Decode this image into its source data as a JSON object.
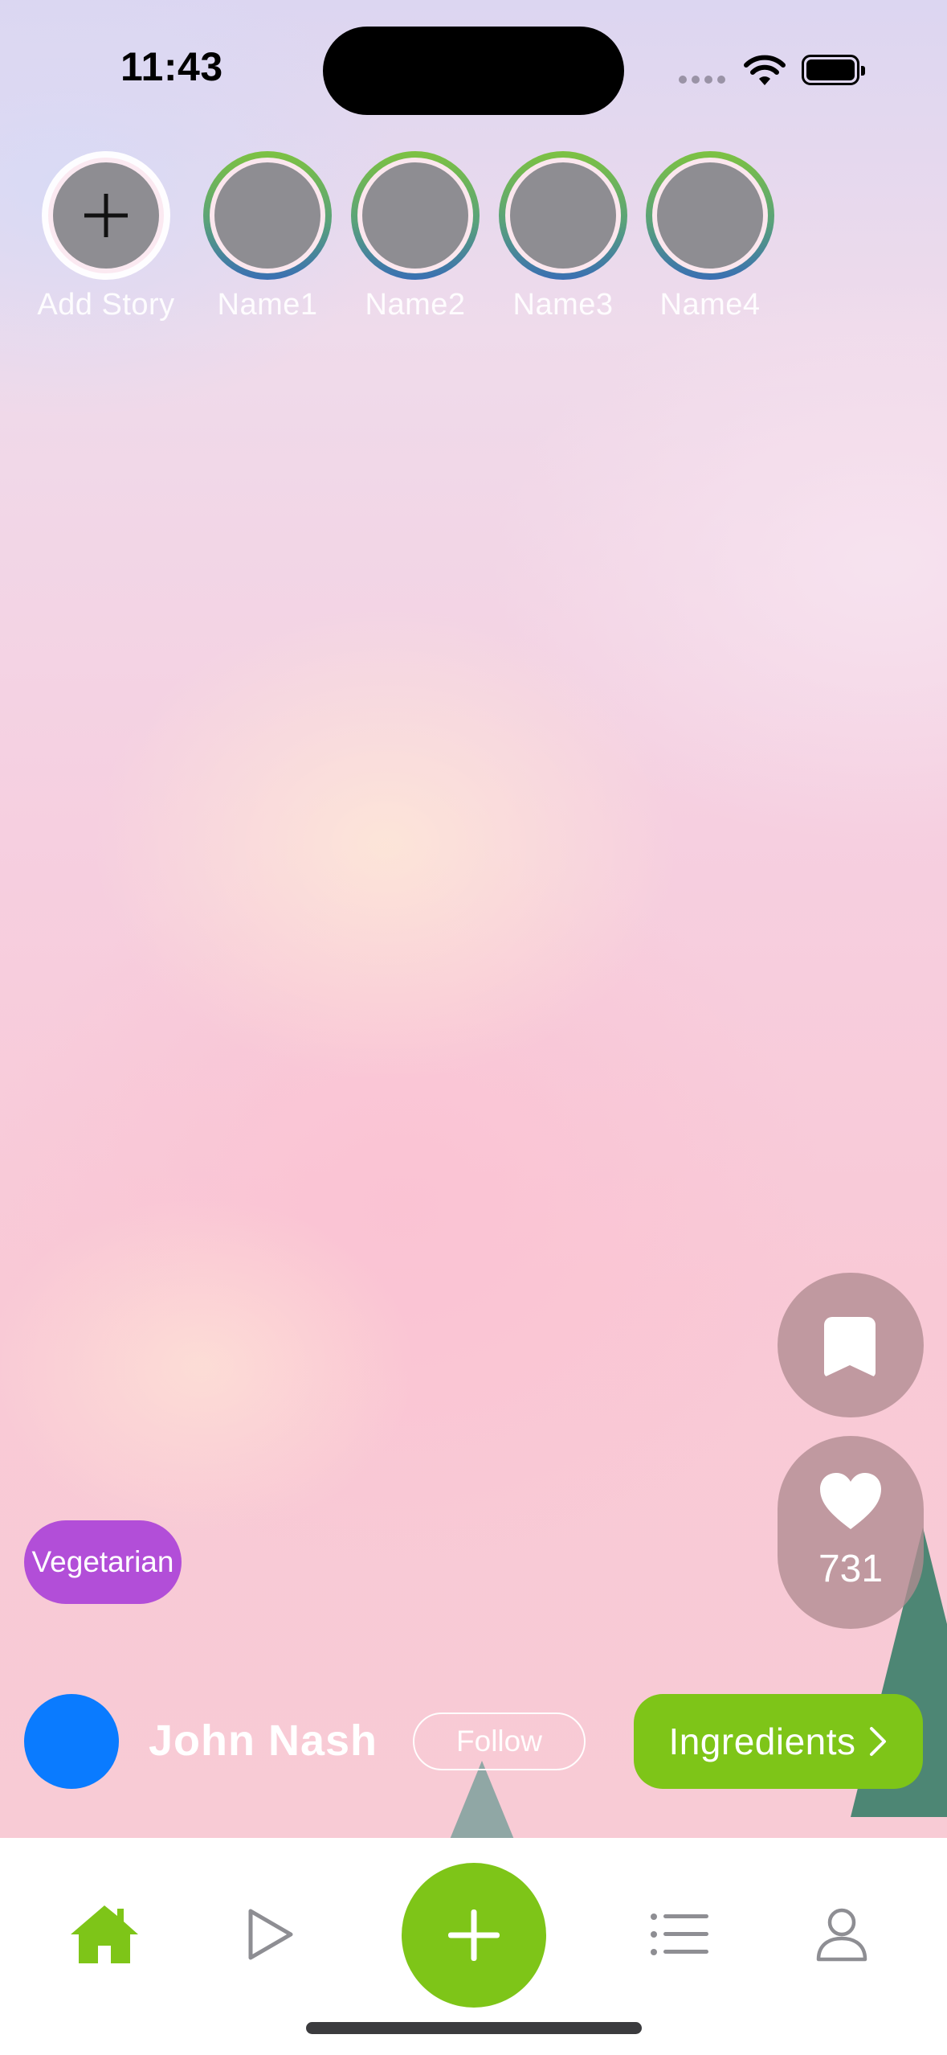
{
  "status_bar": {
    "time": "11:43"
  },
  "stories": {
    "items": [
      {
        "label": "Add Story",
        "type": "add"
      },
      {
        "label": "Name1",
        "type": "user"
      },
      {
        "label": "Name2",
        "type": "user"
      },
      {
        "label": "Name3",
        "type": "user"
      },
      {
        "label": "Name4",
        "type": "user"
      }
    ]
  },
  "actions": {
    "bookmark_icon": "bookmark-icon",
    "like_icon": "heart-icon",
    "like_count": "731"
  },
  "post": {
    "tag": "Vegetarian",
    "author_name": "John Nash",
    "follow_label": "Follow",
    "ingredients_label": "Ingredients"
  },
  "tab_bar": {
    "tabs": [
      {
        "icon": "home-icon",
        "active": true
      },
      {
        "icon": "play-icon",
        "active": false
      },
      {
        "icon": "plus-icon",
        "active": false
      },
      {
        "icon": "list-icon",
        "active": false
      },
      {
        "icon": "profile-icon",
        "active": false
      }
    ]
  },
  "colors": {
    "accent_green": "#7ec518",
    "tag_purple": "#b24ed8",
    "avatar_blue": "#0a7bff",
    "inactive_icon": "#8e8e93"
  }
}
